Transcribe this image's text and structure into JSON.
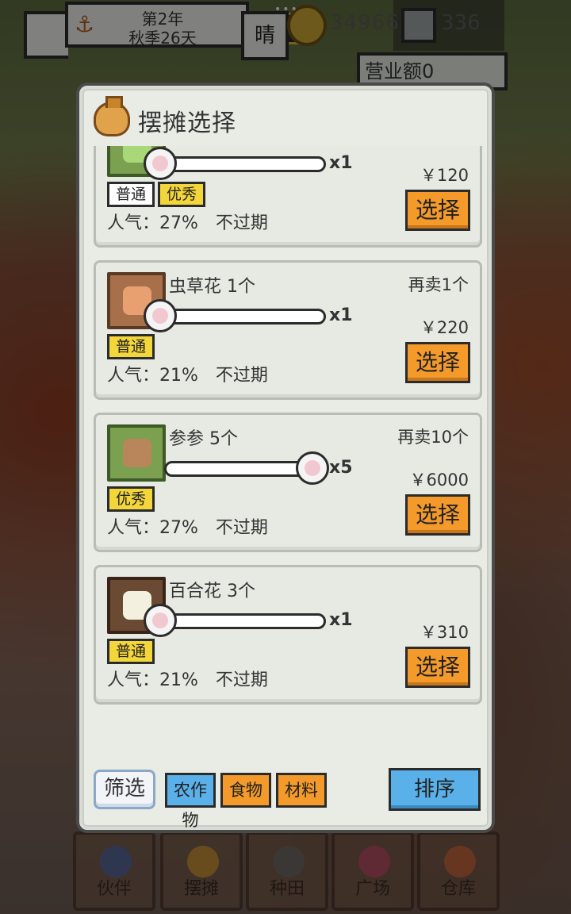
{
  "hud": {
    "year": "第2年",
    "season_day": "秋季26天",
    "weather": "晴",
    "coins": "34966",
    "gems": "336",
    "revenue": "营业额0"
  },
  "modal": {
    "title": "摆摊选择",
    "select_label": "选择"
  },
  "items": [
    {
      "name": "",
      "resell": "",
      "qty": "x1",
      "price": "￥120",
      "tags": [
        "普通",
        "优秀"
      ],
      "popularity": "人气：27%　不过期"
    },
    {
      "name": "虫草花 1个",
      "resell": "再卖1个",
      "qty": "x1",
      "price": "￥220",
      "tags": [
        "普通"
      ],
      "popularity": "人气：21%　不过期"
    },
    {
      "name": "参参 5个",
      "resell": "再卖10个",
      "qty": "x5",
      "price": "￥6000",
      "tags": [
        "优秀"
      ],
      "popularity": "人气：27%　不过期"
    },
    {
      "name": "百合花 3个",
      "resell": "",
      "qty": "x1",
      "price": "￥310",
      "tags": [
        "普通"
      ],
      "popularity": "人气：21%　不过期"
    }
  ],
  "controls": {
    "filter": "筛选",
    "categories": [
      "农作物",
      "食物",
      "材料"
    ],
    "sort": "排序"
  },
  "nav": [
    "伙伴",
    "摆摊",
    "种田",
    "广场",
    "仓库"
  ],
  "colors": {
    "accent_orange": "#f39a2a",
    "accent_blue": "#5ab0e8",
    "tag_yellow": "#f3d63a"
  }
}
